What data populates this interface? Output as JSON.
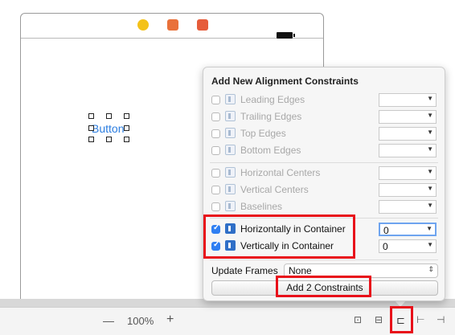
{
  "popover": {
    "title": "Add New Alignment Constraints",
    "edge_rows": [
      {
        "label": "Leading Edges",
        "checked": false,
        "enabled": false
      },
      {
        "label": "Trailing Edges",
        "checked": false,
        "enabled": false
      },
      {
        "label": "Top Edges",
        "checked": false,
        "enabled": false
      },
      {
        "label": "Bottom Edges",
        "checked": false,
        "enabled": false
      }
    ],
    "center_rows": [
      {
        "label": "Horizontal Centers",
        "checked": false,
        "enabled": false
      },
      {
        "label": "Vertical Centers",
        "checked": false,
        "enabled": false
      },
      {
        "label": "Baselines",
        "checked": false,
        "enabled": false
      }
    ],
    "container_rows": [
      {
        "label": "Horizontally in Container",
        "checked": true,
        "value": "0"
      },
      {
        "label": "Vertically in Container",
        "checked": true,
        "value": "0"
      }
    ],
    "update_frames_label": "Update Frames",
    "update_frames_value": "None",
    "add_button_label": "Add 2 Constraints"
  },
  "canvas": {
    "button_text": "Button"
  },
  "bottom_bar": {
    "zoom_out": "—",
    "zoom": "100%",
    "zoom_in": "+"
  },
  "colors": {
    "highlight": "#e8101a",
    "accent": "#2f7ff2",
    "button_text": "#2b7de0"
  }
}
